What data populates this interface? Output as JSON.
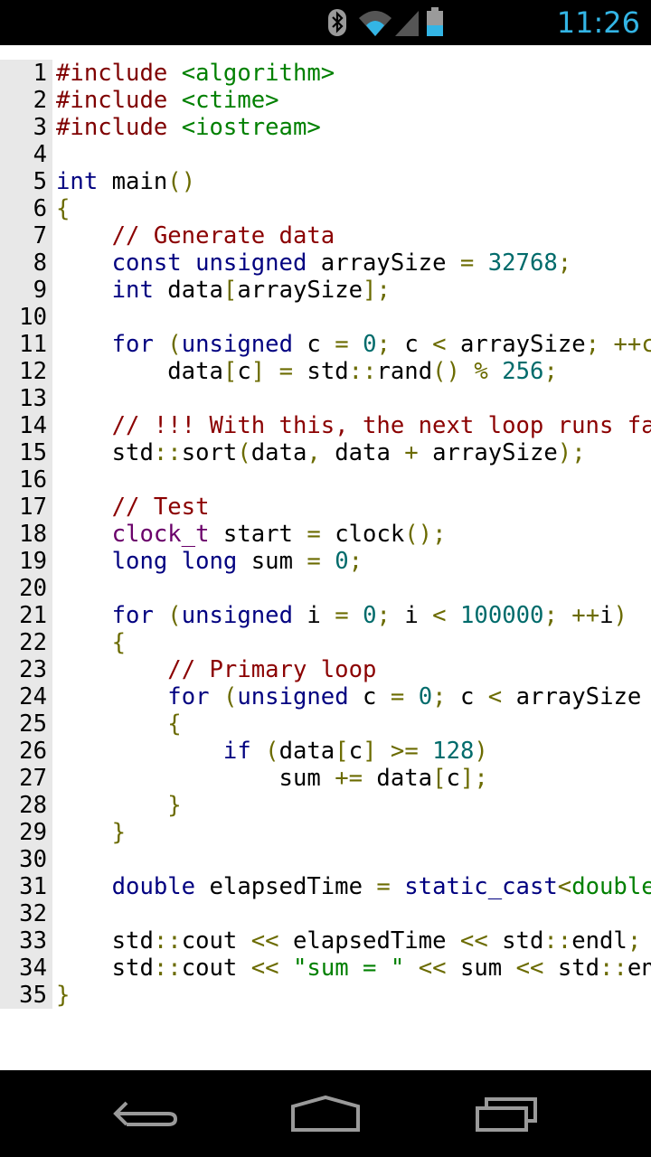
{
  "status_bar": {
    "time": "11:26",
    "icons": [
      "bluetooth-icon",
      "wifi-icon",
      "cell-signal-icon",
      "battery-icon"
    ],
    "accent_color": "#33b5e5"
  },
  "editor": {
    "lines": [
      {
        "number": "1",
        "tokens": [
          {
            "t": "#include ",
            "c": "pre"
          },
          {
            "t": "<algorithm>",
            "c": "str"
          }
        ]
      },
      {
        "number": "2",
        "tokens": [
          {
            "t": "#include ",
            "c": "pre"
          },
          {
            "t": "<ctime>",
            "c": "str"
          }
        ]
      },
      {
        "number": "3",
        "tokens": [
          {
            "t": "#include ",
            "c": "pre"
          },
          {
            "t": "<iostream>",
            "c": "str"
          }
        ]
      },
      {
        "number": "4",
        "tokens": []
      },
      {
        "number": "5",
        "tokens": [
          {
            "t": "int",
            "c": "kw"
          },
          {
            "t": " main",
            "c": "id"
          },
          {
            "t": "()",
            "c": "punc"
          }
        ]
      },
      {
        "number": "6",
        "tokens": [
          {
            "t": "{",
            "c": "punc"
          }
        ]
      },
      {
        "number": "7",
        "tokens": [
          {
            "t": "    ",
            "c": "id"
          },
          {
            "t": "// Generate data",
            "c": "com"
          }
        ]
      },
      {
        "number": "8",
        "tokens": [
          {
            "t": "    ",
            "c": "id"
          },
          {
            "t": "const",
            "c": "kw"
          },
          {
            "t": " ",
            "c": "id"
          },
          {
            "t": "unsigned",
            "c": "kw"
          },
          {
            "t": " arraySize ",
            "c": "id"
          },
          {
            "t": "=",
            "c": "punc"
          },
          {
            "t": " ",
            "c": "id"
          },
          {
            "t": "32768",
            "c": "num"
          },
          {
            "t": ";",
            "c": "punc"
          }
        ]
      },
      {
        "number": "9",
        "tokens": [
          {
            "t": "    ",
            "c": "id"
          },
          {
            "t": "int",
            "c": "kw"
          },
          {
            "t": " data",
            "c": "id"
          },
          {
            "t": "[",
            "c": "punc"
          },
          {
            "t": "arraySize",
            "c": "id"
          },
          {
            "t": "];",
            "c": "punc"
          }
        ]
      },
      {
        "number": "10",
        "tokens": []
      },
      {
        "number": "11",
        "tokens": [
          {
            "t": "    ",
            "c": "id"
          },
          {
            "t": "for",
            "c": "kw"
          },
          {
            "t": " ",
            "c": "id"
          },
          {
            "t": "(",
            "c": "punc"
          },
          {
            "t": "unsigned",
            "c": "kw"
          },
          {
            "t": " c ",
            "c": "id"
          },
          {
            "t": "=",
            "c": "punc"
          },
          {
            "t": " ",
            "c": "id"
          },
          {
            "t": "0",
            "c": "num"
          },
          {
            "t": ";",
            "c": "punc"
          },
          {
            "t": " c ",
            "c": "id"
          },
          {
            "t": "<",
            "c": "punc"
          },
          {
            "t": " arraySize",
            "c": "id"
          },
          {
            "t": ";",
            "c": "punc"
          },
          {
            "t": " ",
            "c": "id"
          },
          {
            "t": "++c",
            "c": "punc"
          }
        ]
      },
      {
        "number": "12",
        "tokens": [
          {
            "t": "        data",
            "c": "id"
          },
          {
            "t": "[",
            "c": "punc"
          },
          {
            "t": "c",
            "c": "id"
          },
          {
            "t": "]",
            "c": "punc"
          },
          {
            "t": " ",
            "c": "id"
          },
          {
            "t": "=",
            "c": "punc"
          },
          {
            "t": " std",
            "c": "id"
          },
          {
            "t": "::",
            "c": "punc"
          },
          {
            "t": "rand",
            "c": "id"
          },
          {
            "t": "()",
            "c": "punc"
          },
          {
            "t": " ",
            "c": "id"
          },
          {
            "t": "%",
            "c": "punc"
          },
          {
            "t": " ",
            "c": "id"
          },
          {
            "t": "256",
            "c": "num"
          },
          {
            "t": ";",
            "c": "punc"
          }
        ]
      },
      {
        "number": "13",
        "tokens": []
      },
      {
        "number": "14",
        "tokens": [
          {
            "t": "    ",
            "c": "id"
          },
          {
            "t": "// !!! With this, the next loop runs faster",
            "c": "com"
          }
        ]
      },
      {
        "number": "15",
        "tokens": [
          {
            "t": "    std",
            "c": "id"
          },
          {
            "t": "::",
            "c": "punc"
          },
          {
            "t": "sort",
            "c": "id"
          },
          {
            "t": "(",
            "c": "punc"
          },
          {
            "t": "data",
            "c": "id"
          },
          {
            "t": ",",
            "c": "punc"
          },
          {
            "t": " data ",
            "c": "id"
          },
          {
            "t": "+",
            "c": "punc"
          },
          {
            "t": " arraySize",
            "c": "id"
          },
          {
            "t": ");",
            "c": "punc"
          }
        ]
      },
      {
        "number": "16",
        "tokens": []
      },
      {
        "number": "17",
        "tokens": [
          {
            "t": "    ",
            "c": "id"
          },
          {
            "t": "// Test",
            "c": "com"
          }
        ]
      },
      {
        "number": "18",
        "tokens": [
          {
            "t": "    ",
            "c": "id"
          },
          {
            "t": "clock_t",
            "c": "type"
          },
          {
            "t": " start ",
            "c": "id"
          },
          {
            "t": "=",
            "c": "punc"
          },
          {
            "t": " clock",
            "c": "id"
          },
          {
            "t": "();",
            "c": "punc"
          }
        ]
      },
      {
        "number": "19",
        "tokens": [
          {
            "t": "    ",
            "c": "id"
          },
          {
            "t": "long",
            "c": "kw"
          },
          {
            "t": " ",
            "c": "id"
          },
          {
            "t": "long",
            "c": "kw"
          },
          {
            "t": " sum ",
            "c": "id"
          },
          {
            "t": "=",
            "c": "punc"
          },
          {
            "t": " ",
            "c": "id"
          },
          {
            "t": "0",
            "c": "num"
          },
          {
            "t": ";",
            "c": "punc"
          }
        ]
      },
      {
        "number": "20",
        "tokens": []
      },
      {
        "number": "21",
        "tokens": [
          {
            "t": "    ",
            "c": "id"
          },
          {
            "t": "for",
            "c": "kw"
          },
          {
            "t": " ",
            "c": "id"
          },
          {
            "t": "(",
            "c": "punc"
          },
          {
            "t": "unsigned",
            "c": "kw"
          },
          {
            "t": " i ",
            "c": "id"
          },
          {
            "t": "=",
            "c": "punc"
          },
          {
            "t": " ",
            "c": "id"
          },
          {
            "t": "0",
            "c": "num"
          },
          {
            "t": ";",
            "c": "punc"
          },
          {
            "t": " i ",
            "c": "id"
          },
          {
            "t": "<",
            "c": "punc"
          },
          {
            "t": " ",
            "c": "id"
          },
          {
            "t": "100000",
            "c": "num"
          },
          {
            "t": ";",
            "c": "punc"
          },
          {
            "t": " ",
            "c": "id"
          },
          {
            "t": "++",
            "c": "punc"
          },
          {
            "t": "i",
            "c": "id"
          },
          {
            "t": ")",
            "c": "punc"
          }
        ]
      },
      {
        "number": "22",
        "tokens": [
          {
            "t": "    ",
            "c": "id"
          },
          {
            "t": "{",
            "c": "punc"
          }
        ]
      },
      {
        "number": "23",
        "tokens": [
          {
            "t": "        ",
            "c": "id"
          },
          {
            "t": "// Primary loop",
            "c": "com"
          }
        ]
      },
      {
        "number": "24",
        "tokens": [
          {
            "t": "        ",
            "c": "id"
          },
          {
            "t": "for",
            "c": "kw"
          },
          {
            "t": " ",
            "c": "id"
          },
          {
            "t": "(",
            "c": "punc"
          },
          {
            "t": "unsigned",
            "c": "kw"
          },
          {
            "t": " c ",
            "c": "id"
          },
          {
            "t": "=",
            "c": "punc"
          },
          {
            "t": " ",
            "c": "id"
          },
          {
            "t": "0",
            "c": "num"
          },
          {
            "t": ";",
            "c": "punc"
          },
          {
            "t": " c ",
            "c": "id"
          },
          {
            "t": "<",
            "c": "punc"
          },
          {
            "t": " arraySize",
            "c": "id"
          }
        ]
      },
      {
        "number": "25",
        "tokens": [
          {
            "t": "        ",
            "c": "id"
          },
          {
            "t": "{",
            "c": "punc"
          }
        ]
      },
      {
        "number": "26",
        "tokens": [
          {
            "t": "            ",
            "c": "id"
          },
          {
            "t": "if",
            "c": "kw"
          },
          {
            "t": " ",
            "c": "id"
          },
          {
            "t": "(",
            "c": "punc"
          },
          {
            "t": "data",
            "c": "id"
          },
          {
            "t": "[",
            "c": "punc"
          },
          {
            "t": "c",
            "c": "id"
          },
          {
            "t": "]",
            "c": "punc"
          },
          {
            "t": " ",
            "c": "id"
          },
          {
            "t": ">=",
            "c": "punc"
          },
          {
            "t": " ",
            "c": "id"
          },
          {
            "t": "128",
            "c": "num"
          },
          {
            "t": ")",
            "c": "punc"
          }
        ]
      },
      {
        "number": "27",
        "tokens": [
          {
            "t": "                sum ",
            "c": "id"
          },
          {
            "t": "+=",
            "c": "punc"
          },
          {
            "t": " data",
            "c": "id"
          },
          {
            "t": "[",
            "c": "punc"
          },
          {
            "t": "c",
            "c": "id"
          },
          {
            "t": "];",
            "c": "punc"
          }
        ]
      },
      {
        "number": "28",
        "tokens": [
          {
            "t": "        ",
            "c": "id"
          },
          {
            "t": "}",
            "c": "punc"
          }
        ]
      },
      {
        "number": "29",
        "tokens": [
          {
            "t": "    ",
            "c": "id"
          },
          {
            "t": "}",
            "c": "punc"
          }
        ]
      },
      {
        "number": "30",
        "tokens": []
      },
      {
        "number": "31",
        "tokens": [
          {
            "t": "    ",
            "c": "id"
          },
          {
            "t": "double",
            "c": "kw"
          },
          {
            "t": " elapsedTime ",
            "c": "id"
          },
          {
            "t": "=",
            "c": "punc"
          },
          {
            "t": " ",
            "c": "id"
          },
          {
            "t": "static_cast",
            "c": "kw"
          },
          {
            "t": "<",
            "c": "punc"
          },
          {
            "t": "double",
            "c": "str"
          }
        ]
      },
      {
        "number": "32",
        "tokens": []
      },
      {
        "number": "33",
        "tokens": [
          {
            "t": "    std",
            "c": "id"
          },
          {
            "t": "::",
            "c": "punc"
          },
          {
            "t": "cout ",
            "c": "id"
          },
          {
            "t": "<<",
            "c": "punc"
          },
          {
            "t": " elapsedTime ",
            "c": "id"
          },
          {
            "t": "<<",
            "c": "punc"
          },
          {
            "t": " std",
            "c": "id"
          },
          {
            "t": "::",
            "c": "punc"
          },
          {
            "t": "endl",
            "c": "id"
          },
          {
            "t": ";",
            "c": "punc"
          }
        ]
      },
      {
        "number": "34",
        "tokens": [
          {
            "t": "    std",
            "c": "id"
          },
          {
            "t": "::",
            "c": "punc"
          },
          {
            "t": "cout ",
            "c": "id"
          },
          {
            "t": "<<",
            "c": "punc"
          },
          {
            "t": " ",
            "c": "id"
          },
          {
            "t": "\"sum = \"",
            "c": "str"
          },
          {
            "t": " ",
            "c": "id"
          },
          {
            "t": "<<",
            "c": "punc"
          },
          {
            "t": " sum ",
            "c": "id"
          },
          {
            "t": "<<",
            "c": "punc"
          },
          {
            "t": " std",
            "c": "id"
          },
          {
            "t": "::",
            "c": "punc"
          },
          {
            "t": "endl",
            "c": "id"
          }
        ]
      },
      {
        "number": "35",
        "tokens": [
          {
            "t": "}",
            "c": "punc"
          }
        ]
      }
    ]
  },
  "nav_bar": {
    "buttons": [
      "back-icon",
      "home-icon",
      "recent-apps-icon"
    ]
  }
}
